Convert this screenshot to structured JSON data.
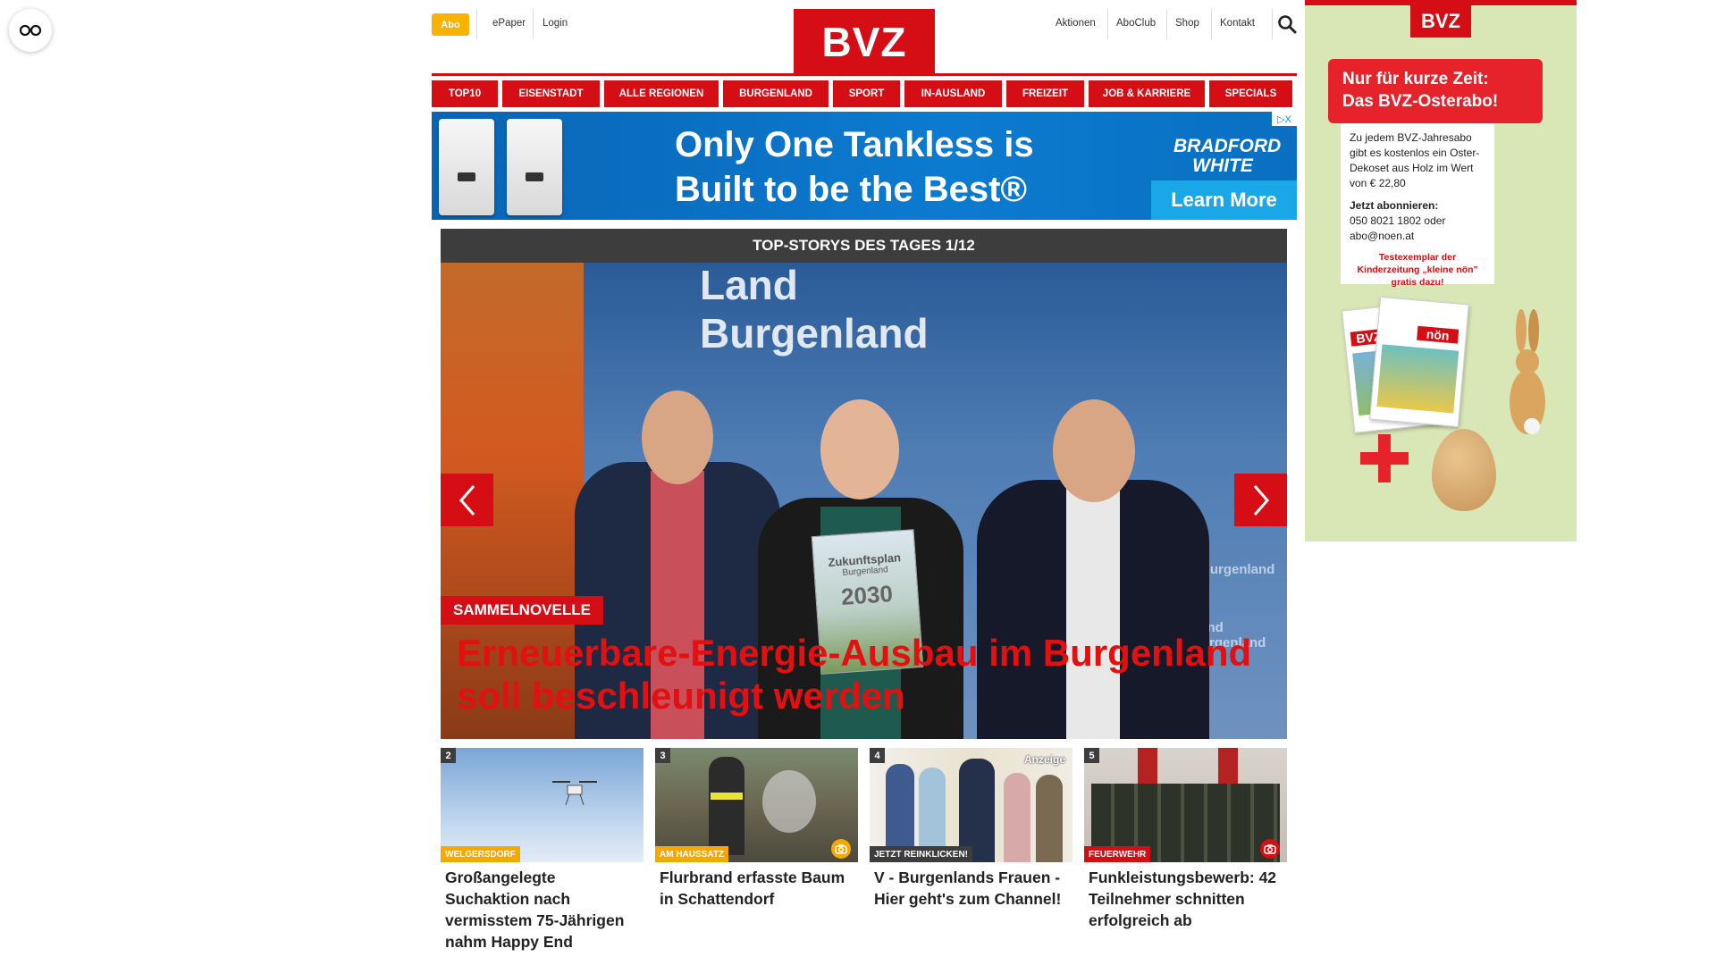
{
  "top_links": {
    "abo": "Abo",
    "epaper": "ePaper",
    "login": "Login",
    "aktionen": "Aktionen",
    "aboclub": "AboClub",
    "shop": "Shop",
    "kontakt": "Kontakt"
  },
  "logo": "BVZ",
  "nav": [
    "TOP10",
    "EISENSTADT",
    "ALLE REGIONEN",
    "BURGENLAND",
    "SPORT",
    "IN-AUSLAND",
    "FREIZEIT",
    "JOB & KARRIERE",
    "SPECIALS"
  ],
  "banner_ad": {
    "headline_1": "Only One Tankless is",
    "headline_2": "Built to be the Best®",
    "brand_1": "BRADFORD",
    "brand_2": "WHITE",
    "cta": "Learn More",
    "adchoices": "▷X"
  },
  "carousel": {
    "bar_title": "TOP-STORYS DES TAGES 1/12",
    "kicker": "SAMMELNOVELLE",
    "headline": "Erneuerbare-Energie-Ausbau im Burgenland soll beschleunigt werden",
    "backdrop_1": "Land",
    "backdrop_2": "Burgenland",
    "backdrop_small": "Land Burgenland",
    "booklet_1": "Zukunftsplan",
    "booklet_2": "Burgenland",
    "booklet_3": "2030"
  },
  "teasers": [
    {
      "num": "2",
      "category": "WELGERSDORF",
      "cat_color": "#f7a800",
      "title": "Großangelegte Suchaktion nach vermisstem 75-Jährigen nahm Happy End",
      "camera": false
    },
    {
      "num": "3",
      "category": "AM HAUSSATZ",
      "cat_color": "#f7a800",
      "title": "Flurbrand erfasste Baum in Schattendorf",
      "camera": true,
      "cam_color": "#f7a800"
    },
    {
      "num": "4",
      "category": "JETZT REINKLICKEN!",
      "cat_color": "#3d3d3d",
      "title": "V - Burgenlands Frauen - Hier geht's zum Channel!",
      "camera": false,
      "ad_label": "Anzeige"
    },
    {
      "num": "5",
      "category": "FEUERWEHR",
      "cat_color": "#d40e14",
      "title": "Funkleistungsbewerb: 42 Teilnehmer schnitten erfolgreich ab",
      "camera": true,
      "cam_color": "#d40e14"
    }
  ],
  "side_ad": {
    "logo": "BVZ",
    "promo_1": "Nur für kurze Zeit:",
    "promo_2": "Das BVZ-Osterabo!",
    "line_1": "Zu jedem BVZ-Jahresabo gibt es kostenlos ein Oster-Dekoset aus Holz im Wert von € 22,80",
    "line_2": "Jetzt abonnieren:",
    "line_3": "050 8021 1802 oder abo@noen.at",
    "line_4": "Testexemplar der Kinderzeitung „kleine nön\" gratis dazu!",
    "mag_1": "BVZ",
    "mag_2": "nön"
  },
  "colors": {
    "brand_red": "#d40e14",
    "abo_yellow": "#f7b300"
  }
}
